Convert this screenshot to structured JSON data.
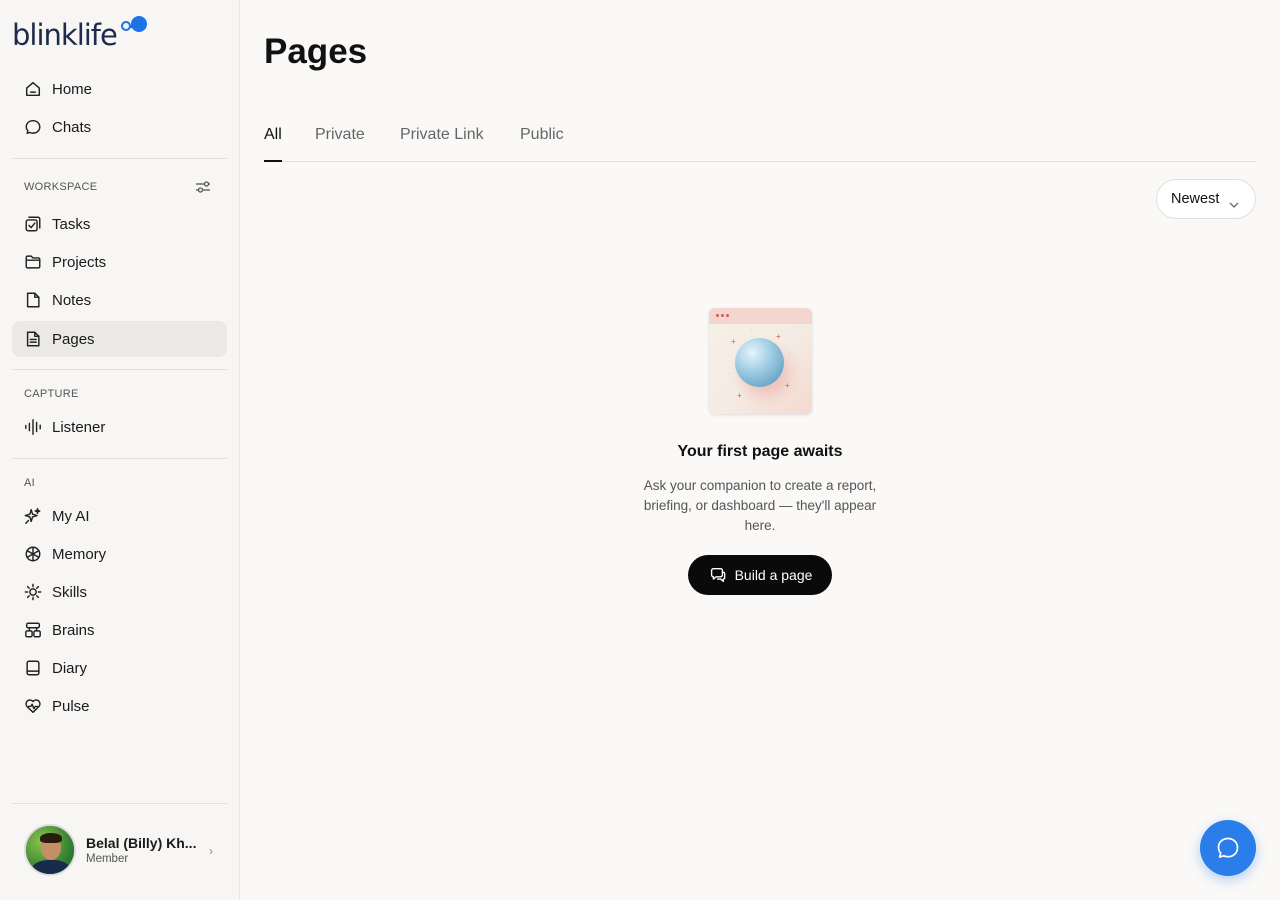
{
  "brand": {
    "logo_text": "blinklife",
    "accent": "#1a73e8"
  },
  "sidebar": {
    "main_items": [
      {
        "label": "Home",
        "icon": "home-icon"
      },
      {
        "label": "Chats",
        "icon": "chat-icon"
      }
    ],
    "workspace": {
      "label": "WORKSPACE",
      "items": [
        {
          "label": "Tasks",
          "icon": "tasks-icon"
        },
        {
          "label": "Projects",
          "icon": "folder-icon"
        },
        {
          "label": "Notes",
          "icon": "note-icon"
        },
        {
          "label": "Pages",
          "icon": "page-icon",
          "active": true
        }
      ]
    },
    "capture": {
      "label": "CAPTURE",
      "items": [
        {
          "label": "Listener",
          "icon": "waveform-icon"
        }
      ]
    },
    "ai": {
      "label": "AI",
      "items": [
        {
          "label": "My AI",
          "icon": "sparkle-icon"
        },
        {
          "label": "Memory",
          "icon": "memory-icon"
        },
        {
          "label": "Skills",
          "icon": "skills-icon"
        },
        {
          "label": "Brains",
          "icon": "brains-icon"
        },
        {
          "label": "Diary",
          "icon": "diary-icon"
        },
        {
          "label": "Pulse",
          "icon": "pulse-heart-icon"
        }
      ]
    },
    "user": {
      "name": "Belal (Billy) Kh...",
      "role": "Member"
    }
  },
  "main": {
    "title": "Pages",
    "tabs": [
      {
        "label": "All",
        "active": true
      },
      {
        "label": "Private"
      },
      {
        "label": "Private Link"
      },
      {
        "label": "Public"
      }
    ],
    "sort": {
      "selected": "Newest"
    },
    "empty_state": {
      "title": "Your first page awaits",
      "description": "Ask your companion to create a report, briefing, or dashboard — they'll appear here.",
      "button_label": "Build a page"
    }
  },
  "colors": {
    "fab": "#2b7de9",
    "primary_button": "#0a0a0a",
    "active_nav_bg": "#ebe9e6"
  }
}
